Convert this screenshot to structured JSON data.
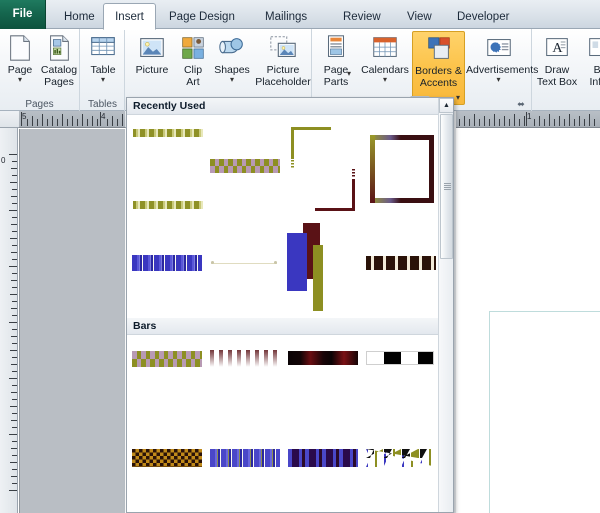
{
  "app": {
    "name": "Microsoft Publisher 2010",
    "accent_file_tab": "#15664e",
    "accent_selected_button": "#fcc34a"
  },
  "tabs": [
    {
      "label": "File",
      "name": "tab-file",
      "active": false,
      "is_file": true
    },
    {
      "label": "Home",
      "name": "tab-home",
      "active": false
    },
    {
      "label": "Insert",
      "name": "tab-insert",
      "active": true
    },
    {
      "label": "Page Design",
      "name": "tab-page-design",
      "active": false
    },
    {
      "label": "Mailings",
      "name": "tab-mailings",
      "active": false
    },
    {
      "label": "Review",
      "name": "tab-review",
      "active": false
    },
    {
      "label": "View",
      "name": "tab-view",
      "active": false
    },
    {
      "label": "Developer",
      "name": "tab-developer",
      "active": false
    }
  ],
  "ribbon": {
    "collapse_arrow": "▲",
    "dialog_launcher": "⬌",
    "groups": [
      {
        "label": "Pages",
        "name": "ribbon-group-pages"
      },
      {
        "label": "Tables",
        "name": "ribbon-group-tables"
      },
      {
        "label": "",
        "name": "ribbon-group-illustrations"
      },
      {
        "label": "",
        "name": "ribbon-group-building-blocks"
      },
      {
        "label": "",
        "name": "ribbon-group-text"
      }
    ],
    "buttons": [
      {
        "label": "Page",
        "name": "button-page",
        "icon": "page-icon",
        "dropdown": true
      },
      {
        "label": "Catalog\nPages",
        "name": "button-catalog-pages",
        "icon": "catalog-pages-icon",
        "dropdown": false
      },
      {
        "label": "Table",
        "name": "button-table",
        "icon": "table-icon",
        "dropdown": true
      },
      {
        "label": "Picture",
        "name": "button-picture",
        "icon": "picture-icon",
        "dropdown": false
      },
      {
        "label": "Clip\nArt",
        "name": "button-clip-art",
        "icon": "clip-art-icon",
        "dropdown": false
      },
      {
        "label": "Shapes",
        "name": "button-shapes",
        "icon": "shapes-icon",
        "dropdown": true
      },
      {
        "label": "Picture\nPlaceholder",
        "name": "button-picture-placeholder",
        "icon": "picture-placeholder-icon",
        "dropdown": false
      },
      {
        "label": "Page\nParts",
        "name": "button-page-parts",
        "icon": "page-parts-icon",
        "dropdown": true
      },
      {
        "label": "Calendars",
        "name": "button-calendars",
        "icon": "calendars-icon",
        "dropdown": true
      },
      {
        "label": "Borders &\nAccents",
        "name": "button-borders-and-accents",
        "icon": "borders-accents-icon",
        "dropdown": true,
        "selected": true
      },
      {
        "label": "Advertisements",
        "name": "button-advertisements",
        "icon": "advertisements-icon",
        "dropdown": true
      },
      {
        "label": "Draw\nText Box",
        "name": "button-draw-text-box",
        "icon": "draw-text-box-icon",
        "dropdown": false
      },
      {
        "label": "Bu\nInfor",
        "name": "button-business-information",
        "icon": "business-information-icon",
        "dropdown": false
      }
    ]
  },
  "gallery": {
    "name": "borders-and-accents-gallery",
    "sections": [
      {
        "title": "Recently Used",
        "name": "gallery-section-recently-used"
      },
      {
        "title": "Bars",
        "name": "gallery-section-bars"
      }
    ],
    "scrollbar": {
      "up_arrow": "▲",
      "name": "gallery-scrollbar"
    },
    "items": [
      {
        "name": "gallery-item-floral-frame",
        "section": 0,
        "row": 0,
        "col": 0
      },
      {
        "name": "gallery-item-diamond-bar",
        "section": 0,
        "row": 0,
        "col": 1
      },
      {
        "name": "gallery-item-corner-accent",
        "section": 0,
        "row": 0,
        "col": 2
      },
      {
        "name": "gallery-item-gradient-frame",
        "section": 0,
        "row": 0,
        "col": 3
      },
      {
        "name": "gallery-item-blue-stripes-bar",
        "section": 0,
        "row": 1,
        "col": 0
      },
      {
        "name": "gallery-item-thin-line-accent",
        "section": 0,
        "row": 1,
        "col": 1
      },
      {
        "name": "gallery-item-color-blocks",
        "section": 0,
        "row": 1,
        "col": 2
      },
      {
        "name": "gallery-item-dotted-dark-bar",
        "section": 0,
        "row": 1,
        "col": 3
      },
      {
        "name": "gallery-item-diamond-checker",
        "section": 1,
        "row": 0,
        "col": 0
      },
      {
        "name": "gallery-item-faded-ticks",
        "section": 1,
        "row": 0,
        "col": 1
      },
      {
        "name": "gallery-item-dark-red-gradient",
        "section": 1,
        "row": 0,
        "col": 2
      },
      {
        "name": "gallery-item-black-white-blocks",
        "section": 1,
        "row": 0,
        "col": 3
      },
      {
        "name": "gallery-item-gold-checkerboard",
        "section": 1,
        "row": 1,
        "col": 0
      },
      {
        "name": "gallery-item-blue-vertical-bars",
        "section": 1,
        "row": 1,
        "col": 1
      },
      {
        "name": "gallery-item-purple-squares",
        "section": 1,
        "row": 1,
        "col": 2
      },
      {
        "name": "gallery-item-triangle-pattern",
        "section": 1,
        "row": 1,
        "col": 3
      }
    ]
  },
  "workspace": {
    "horizontal_ruler": {
      "name": "horizontal-ruler",
      "labels_left": [
        "5",
        "4"
      ],
      "labels_right": [
        "1"
      ]
    },
    "vertical_ruler": {
      "name": "vertical-ruler",
      "labels": [
        "0"
      ]
    },
    "page": {
      "name": "publication-page"
    }
  }
}
